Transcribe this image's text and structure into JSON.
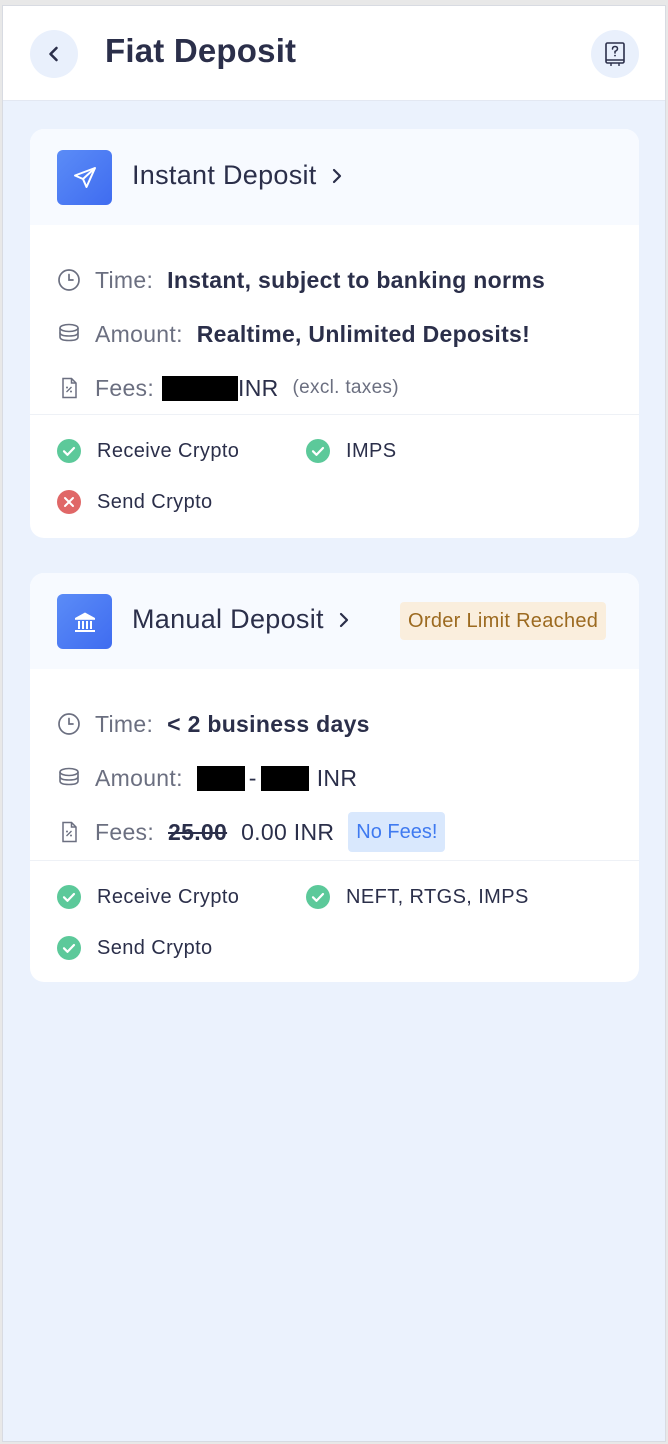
{
  "header": {
    "title": "Fiat Deposit"
  },
  "instant": {
    "title": "Instant Deposit",
    "time_label": "Time:",
    "time_value": "Instant, subject to banking norms",
    "amount_label": "Amount:",
    "amount_value": "Realtime, Unlimited Deposits!",
    "fees_label": "Fees:",
    "fees_currency": "INR",
    "fees_note": "(excl. taxes)",
    "features": [
      {
        "label": "Receive Crypto",
        "status": "check"
      },
      {
        "label": "IMPS",
        "status": "check"
      },
      {
        "label": "Send Crypto",
        "status": "cross"
      }
    ]
  },
  "manual": {
    "title": "Manual Deposit",
    "badge": "Order Limit Reached",
    "time_label": "Time:",
    "time_value": "< 2 business days",
    "amount_label": "Amount:",
    "amount_separator": "-",
    "amount_currency": "INR",
    "fees_label": "Fees:",
    "fees_old": "25.00",
    "fees_new": "0.00 INR",
    "fees_badge": "No Fees!",
    "features": [
      {
        "label": "Receive Crypto",
        "status": "check"
      },
      {
        "label": "NEFT, RTGS, IMPS",
        "status": "check"
      },
      {
        "label": "Send Crypto",
        "status": "check"
      }
    ]
  },
  "colors": {
    "accent": "#3f6cf0",
    "check": "#5cc99a",
    "cross": "#e06767",
    "badge_bg": "#faeedd",
    "badge_text": "#9c6a20"
  }
}
